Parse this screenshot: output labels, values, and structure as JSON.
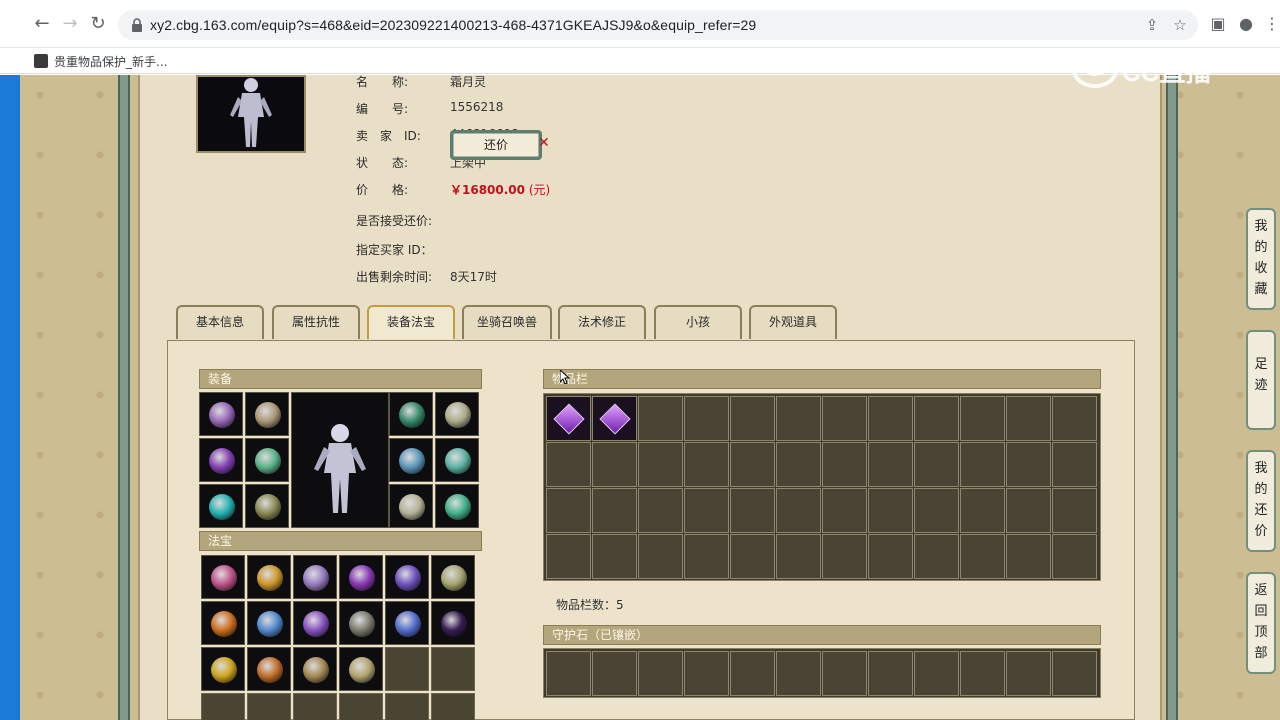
{
  "browser": {
    "url": "xy2.cbg.163.com/equip?s=468&eid=202309221400213-468-4371GKEAJSJ9&o&equip_refer=29",
    "bookmark": "贵重物品保护_新手..."
  },
  "character": {
    "rows": [
      {
        "label": "名　　称:",
        "value": "霜月灵"
      },
      {
        "label": "编　　号:",
        "value": "1556218"
      },
      {
        "label": "卖　家　ID:",
        "value": "446816698"
      },
      {
        "label": "状　　态:",
        "value": "上架中"
      }
    ],
    "price_label": "价　　格:",
    "price_value": "￥16800.00",
    "price_unit": "(元)",
    "counter_label": "是否接受还价:",
    "counter_button": "还价",
    "buyer_label": "指定买家 ID：",
    "remaining_label": "出售剩余时间:",
    "remaining_value": "8天17时"
  },
  "tabs": [
    "基本信息",
    "属性抗性",
    "装备法宝",
    "坐骑召唤兽",
    "法术修正",
    "小孩",
    "外观道具"
  ],
  "active_tab": 2,
  "sections": {
    "equipment": "装备",
    "fabao": "法宝",
    "inventory": "物品栏",
    "inventory_count": "物品栏数：5",
    "guard_stone": "守护石（已镶嵌）"
  },
  "side_tabs": [
    "我的收藏",
    "足迹",
    "我的还价",
    "返回顶部"
  ],
  "watermark": "CC直播",
  "colors": {
    "accent": "#c0101a",
    "frame": "#7f9a8a",
    "panel": "#e9dfc6"
  }
}
